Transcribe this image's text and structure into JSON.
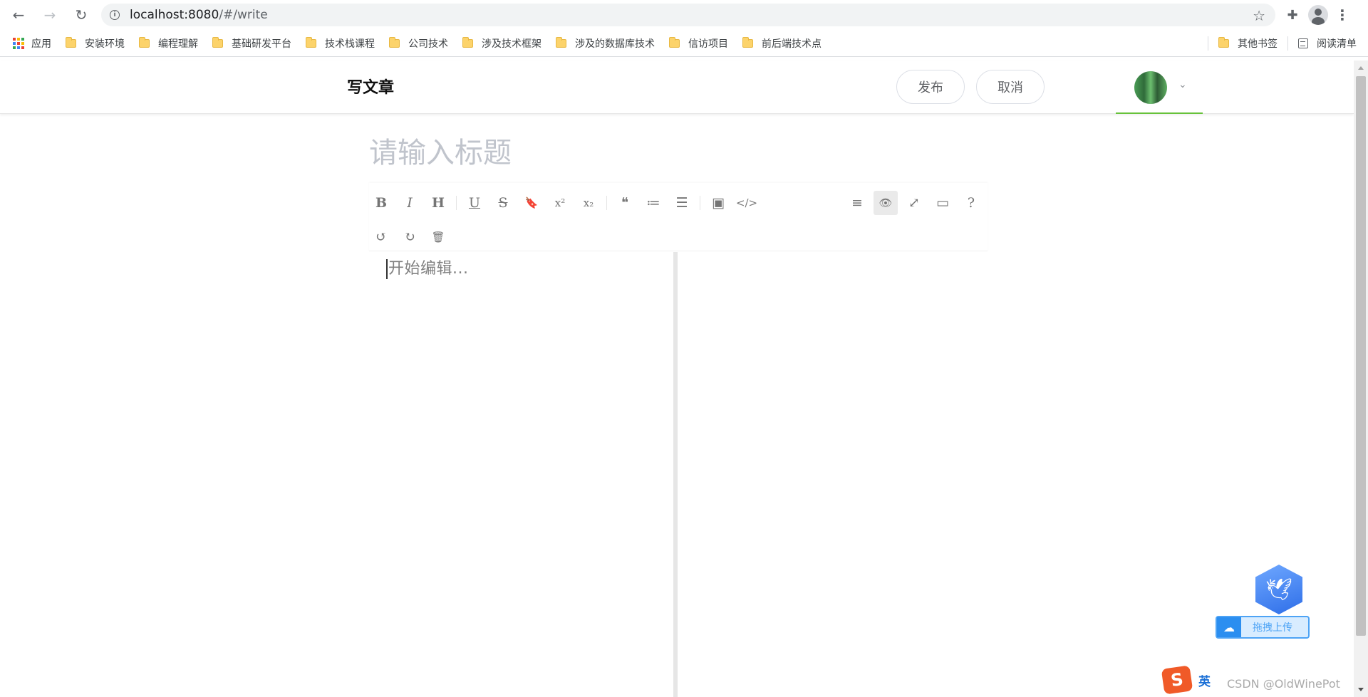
{
  "browser": {
    "url_host": "localhost:8080",
    "url_path": "/#/write",
    "back_icon": "arrow-left-icon",
    "forward_icon": "arrow-right-icon",
    "reload_icon": "reload-icon"
  },
  "bookmarks": {
    "apps_label": "应用",
    "items": [
      "安装环境",
      "编程理解",
      "基础研发平台",
      "技术栈课程",
      "公司技术",
      "涉及技术框架",
      "涉及的数据库技术",
      "信访项目",
      "前后端技术点"
    ],
    "other_label": "其他书签",
    "reading_list_label": "阅读清单"
  },
  "header": {
    "title": "写文章",
    "publish_label": "发布",
    "cancel_label": "取消"
  },
  "editor": {
    "title_placeholder": "请输入标题",
    "content_placeholder": "开始编辑...",
    "toolbar_left": [
      {
        "name": "bold",
        "glyph": "B"
      },
      {
        "name": "italic",
        "glyph": "I"
      },
      {
        "name": "header",
        "glyph": "H"
      },
      {
        "name": "underline",
        "glyph": "U"
      },
      {
        "name": "strikethrough",
        "glyph": "S"
      },
      {
        "name": "mark",
        "glyph": "🔖"
      },
      {
        "name": "superscript",
        "glyph": "x²"
      },
      {
        "name": "subscript",
        "glyph": "x₂"
      },
      {
        "name": "quote",
        "glyph": "❝"
      },
      {
        "name": "ordered-list",
        "glyph": "≔"
      },
      {
        "name": "unordered-list",
        "glyph": "☰"
      },
      {
        "name": "image",
        "glyph": "▣"
      },
      {
        "name": "code",
        "glyph": "</>"
      }
    ],
    "toolbar_row2": [
      {
        "name": "undo",
        "glyph": "↺"
      },
      {
        "name": "redo",
        "glyph": "↻"
      },
      {
        "name": "trash",
        "glyph": "🗑"
      }
    ],
    "toolbar_right": [
      {
        "name": "navigation",
        "glyph": "≡"
      },
      {
        "name": "preview-toggle",
        "glyph": "👁"
      },
      {
        "name": "fullscreen",
        "glyph": "⤢"
      },
      {
        "name": "window",
        "glyph": "▭"
      },
      {
        "name": "help",
        "glyph": "?"
      }
    ]
  },
  "widgets": {
    "upload_label": "拖拽上传",
    "ime_lang": "英",
    "watermark": "CSDN @OldWinePot"
  },
  "colors": {
    "accent_green": "#67c23a",
    "upload_blue": "#4da3f5"
  }
}
